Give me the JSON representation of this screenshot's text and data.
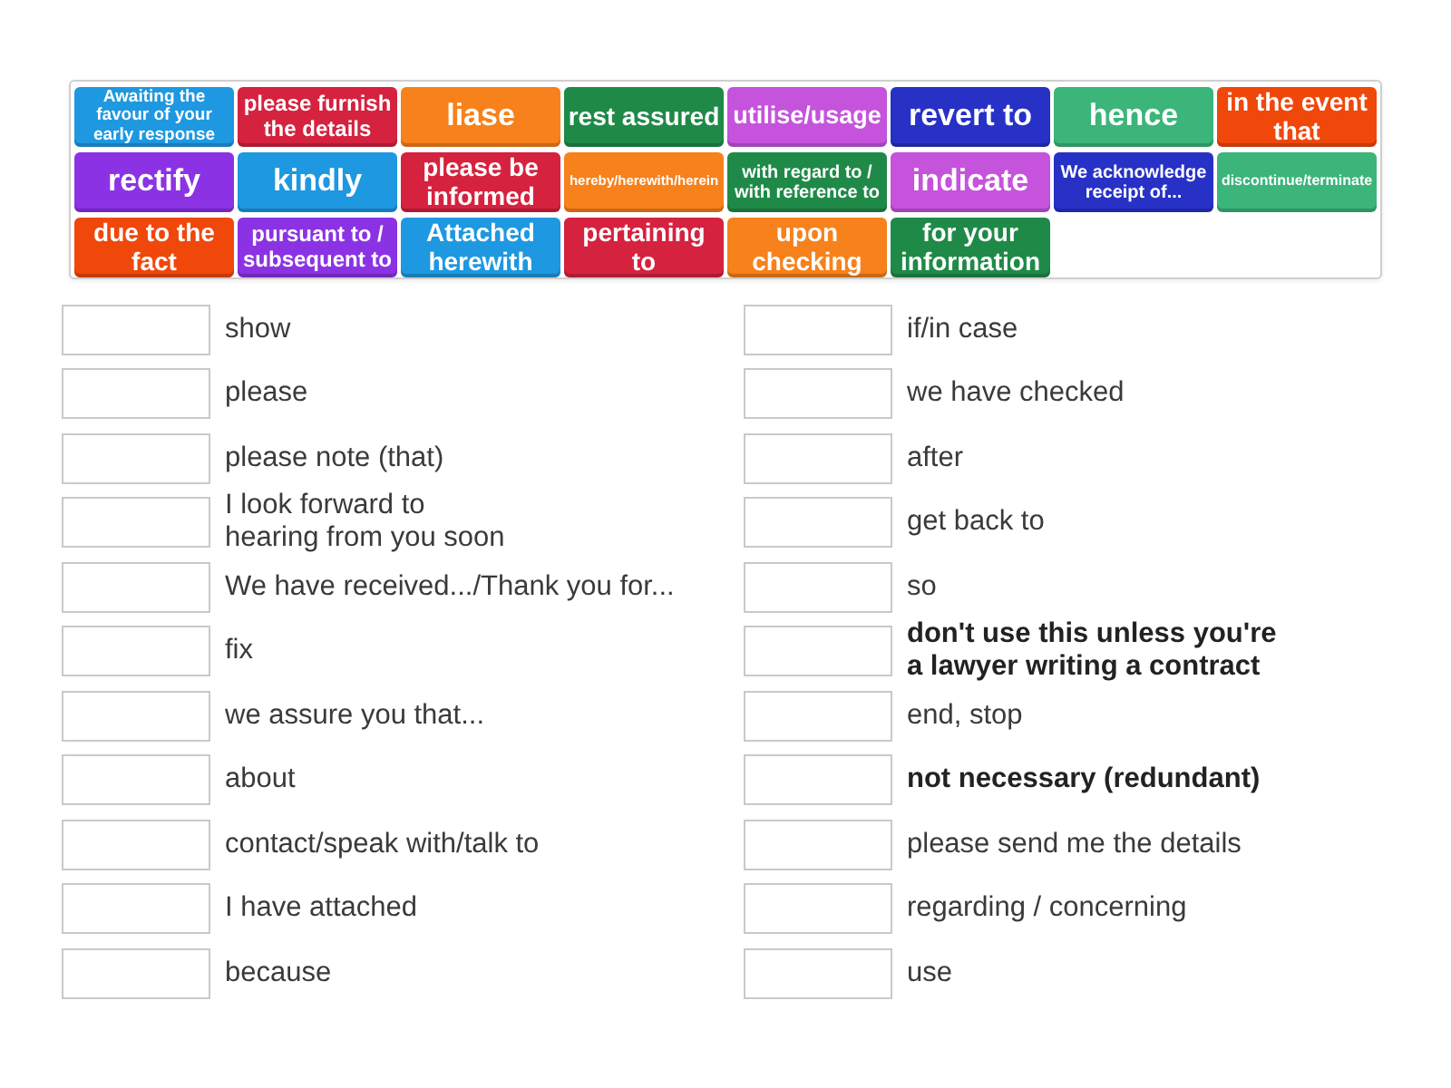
{
  "tiles": [
    {
      "text": "Awaiting the favour of your early response",
      "color": "#1e98e0"
    },
    {
      "text": "please furnish the details",
      "color": "#d5223f"
    },
    {
      "text": "liase",
      "color": "#f7811a"
    },
    {
      "text": "rest assured",
      "color": "#1f8a48"
    },
    {
      "text": "utilise/usage",
      "color": "#c553dc"
    },
    {
      "text": "revert to",
      "color": "#2731c6"
    },
    {
      "text": "hence",
      "color": "#3bb57a"
    },
    {
      "text": "in the event that",
      "color": "#f0470b"
    },
    {
      "text": "rectify",
      "color": "#8b33e4"
    },
    {
      "text": "kindly",
      "color": "#1e98e0"
    },
    {
      "text": "please be informed",
      "color": "#d5223f"
    },
    {
      "text": "hereby/herewith/herein",
      "color": "#f7811a"
    },
    {
      "text": "with regard to / with reference to",
      "color": "#1f8a48"
    },
    {
      "text": "indicate",
      "color": "#c553dc"
    },
    {
      "text": "We acknowledge receipt of...",
      "color": "#2731c6"
    },
    {
      "text": "discontinue/terminate",
      "color": "#3bb57a"
    },
    {
      "text": "due to the fact",
      "color": "#f0470b"
    },
    {
      "text": "pursuant to / subsequent to",
      "color": "#8b33e4"
    },
    {
      "text": "Attached herewith",
      "color": "#1e98e0"
    },
    {
      "text": "pertaining to",
      "color": "#d5223f"
    },
    {
      "text": "upon checking",
      "color": "#f7811a"
    },
    {
      "text": "for your information",
      "color": "#1f8a48"
    }
  ],
  "columns": [
    {
      "rows": [
        {
          "text": "show",
          "emphasized": false
        },
        {
          "text": "please",
          "emphasized": false
        },
        {
          "text": "please note (that)",
          "emphasized": false
        },
        {
          "text": "I look forward to\nhearing from you soon",
          "emphasized": false
        },
        {
          "text": "We have received.../Thank you for...",
          "emphasized": false
        },
        {
          "text": "fix",
          "emphasized": false
        },
        {
          "text": "we assure you that...",
          "emphasized": false
        },
        {
          "text": "about",
          "emphasized": false
        },
        {
          "text": "contact/speak with/talk to",
          "emphasized": false
        },
        {
          "text": "I have attached",
          "emphasized": false
        },
        {
          "text": "because",
          "emphasized": false
        }
      ]
    },
    {
      "rows": [
        {
          "text": "if/in case",
          "emphasized": false
        },
        {
          "text": "we have checked",
          "emphasized": false
        },
        {
          "text": "after",
          "emphasized": false
        },
        {
          "text": "get back to",
          "emphasized": false
        },
        {
          "text": "so",
          "emphasized": false
        },
        {
          "text": "don't use this unless you're\na lawyer writing a contract",
          "emphasized": true
        },
        {
          "text": "end, stop",
          "emphasized": false
        },
        {
          "text": "not necessary (redundant)",
          "emphasized": true
        },
        {
          "text": "please send me the details",
          "emphasized": false
        },
        {
          "text": "regarding / concerning",
          "emphasized": false
        },
        {
          "text": "use",
          "emphasized": false
        }
      ]
    }
  ]
}
